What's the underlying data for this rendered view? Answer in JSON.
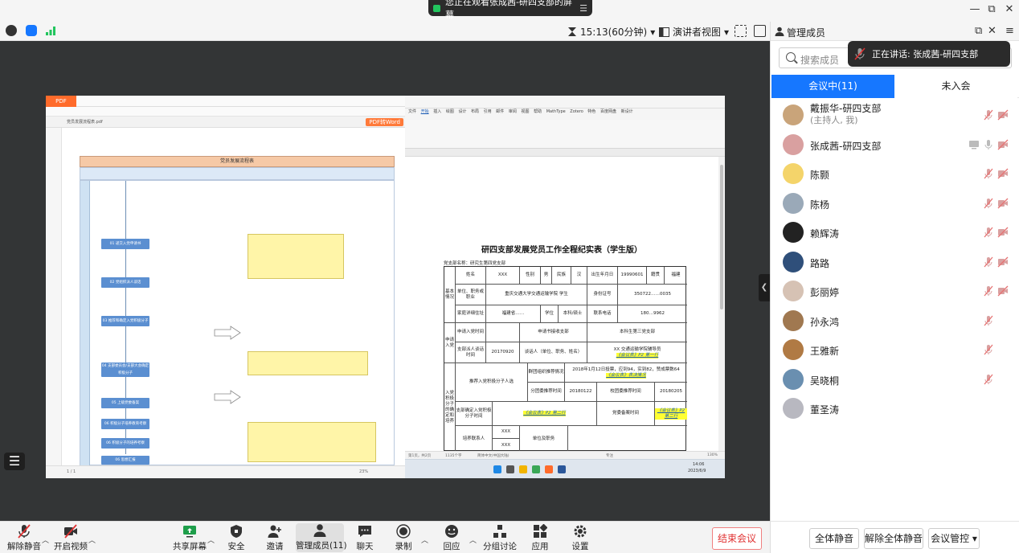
{
  "banner": {
    "text": "您正在观看张成茜-研四支部的屏幕",
    "menu": "☰"
  },
  "window": {
    "minimize": "—",
    "restore": "⧉",
    "close": "✕"
  },
  "meeting": {
    "timer": "15:13(60分钟)",
    "view_mode": "演讲者视图",
    "caret": "▾"
  },
  "panel": {
    "title": "管理成员",
    "search_placeholder": "搜索成员",
    "speaking": "正在讲话: 张成茜-研四支部",
    "tab_in": "会议中(11)",
    "tab_out": "未入会",
    "members": [
      {
        "name": "戴振华-研四支部",
        "sub": "(主持人, 我)",
        "mic": "off",
        "cam": "off",
        "avatar_color": "#c9a47a"
      },
      {
        "name": "张成茜-研四支部",
        "sub": "",
        "mic": "on",
        "cam": "off",
        "avatar_color": "#d9a0a0",
        "screen": true
      },
      {
        "name": "陈颢",
        "sub": "",
        "mic": "off",
        "cam": "off",
        "avatar_color": "#f4d46a"
      },
      {
        "name": "陈杨",
        "sub": "",
        "mic": "off",
        "cam": "off",
        "avatar_color": "#9aa9b8"
      },
      {
        "name": "赖辉涛",
        "sub": "",
        "mic": "off",
        "cam": "off",
        "avatar_color": "#222222"
      },
      {
        "name": "路路",
        "sub": "",
        "mic": "off",
        "cam": "off",
        "avatar_color": "#2f4f7a"
      },
      {
        "name": "彭丽婷",
        "sub": "",
        "mic": "off",
        "cam": "off",
        "avatar_color": "#d6c2b4"
      },
      {
        "name": "孙永鸿",
        "sub": "",
        "mic": "off",
        "cam": "none",
        "avatar_color": "#a07850"
      },
      {
        "name": "王雅新",
        "sub": "",
        "mic": "off",
        "cam": "none",
        "avatar_color": "#b07a44"
      },
      {
        "name": "吴晓桐",
        "sub": "",
        "mic": "off",
        "cam": "none",
        "avatar_color": "#6a8fb0"
      },
      {
        "name": "董圣涛",
        "sub": "",
        "mic": "none",
        "cam": "none",
        "avatar_color": "#b8b8c0"
      }
    ],
    "mute_all": "全体静音",
    "unmute_all": "解除全体静音",
    "meeting_control": "会议管控"
  },
  "toolbar": {
    "unmute": "解除静音",
    "start_video": "开启视频",
    "share_screen": "共享屏幕",
    "security": "安全",
    "invite": "邀请",
    "manage_members": "管理成员(11)",
    "chat": "聊天",
    "record": "录制",
    "reactions": "回应",
    "breakout": "分组讨论",
    "apps": "应用",
    "settings": "设置",
    "end_meeting": "结束会议"
  },
  "shared_screen": {
    "pdf": {
      "logo": "PDF",
      "tab": "党员发展流程表.pdf",
      "to_word": "PDF转Word",
      "chart_title": "党员发展流程表",
      "steps": [
        "01 递交入党申请书",
        "02 党组织派人谈话",
        "03 推荐和确定入党积极分子",
        "04 支部委员会/支部大会确定积极分子",
        "05 上级党委备案",
        "06 积极分子培养教育考察",
        "06 积极分子的培养考察",
        "06 思想汇报"
      ],
      "page": "1 / 1",
      "zoom": "23%"
    },
    "word": {
      "menu": [
        "文件",
        "开始",
        "插入",
        "绘图",
        "设计",
        "布局",
        "引用",
        "邮件",
        "审阅",
        "视图",
        "帮助",
        "MathType",
        "Zotero",
        "特色",
        "百度网盘",
        "新设计",
        "布局"
      ],
      "doc_title": "研四支部发展党员工作全程纪实表（学生版）",
      "branch": "党支部名称：研究生第四党支部",
      "rows": {
        "basic": "基本情况",
        "name_label": "姓名",
        "name_value": "XXX",
        "gender_label": "性别",
        "gender_value": "男",
        "ethnic_label": "民族",
        "ethnic_value": "汉",
        "birth_label": "出生年月日",
        "birth_value": "19990601",
        "origin_label": "籍贯",
        "origin_value": "福建",
        "unit_label": "单位、职务或职业",
        "unit_value": "重庆交通大学交通运输学院 学生",
        "id_label": "身份证号",
        "id_value": "350722……0035",
        "home_label": "家庭详细住址",
        "home_value": "福建省……",
        "degree_label": "学位",
        "degree_value": "本科/硕士",
        "phone_label": "联系电话",
        "phone_value": "180…9962",
        "apply": "申请入党",
        "apply_time_label": "申请入党时间",
        "apply_branch_label": "申请书接收支部",
        "apply_branch_value": "本科生第三党支部",
        "talk_label": "支部派人谈话时间",
        "talk_value": "20170920",
        "talker_label": "谈话人（单位、职务、姓名）",
        "talker_value": "XX 交通运输学院辅导员",
        "talker_note": "《会议表》P2 第一行",
        "activist": "入党积极分子的确定和培养",
        "recommend_label": "推荐入党积极分子人选",
        "recommend_text": "群团组织推荐情况",
        "recommend_value": "2018年1月12日投票，应到94，实到82，赞成票数64",
        "recommend_note": "《会议表》表决情况",
        "branch_rec_label": "分团委推荐时间",
        "branch_rec_value": "20180122",
        "class_rec_label": "校团委推荐时间",
        "class_rec_value": "20180205",
        "confirm_label": "支部确定入党积极分子时间",
        "confirm_note": "《会议表》P2 第二行",
        "filing_label": "党委备案时间",
        "filing_note": "《会议表》P2 第二行",
        "trainer_label": "培养联系人",
        "trainer_value1": "XXX",
        "trainer_value2": "XXX",
        "trainer_job": "单位及职务",
        "exam_label": "支部考察时间"
      },
      "status_page": "第1页，共2页",
      "status_words": "1135个字",
      "status_lang": "简体中文(中国大陆)",
      "status_focus": "专注",
      "status_zoom": "130%",
      "clock_time": "14:06",
      "clock_date": "2023/6/9"
    }
  }
}
